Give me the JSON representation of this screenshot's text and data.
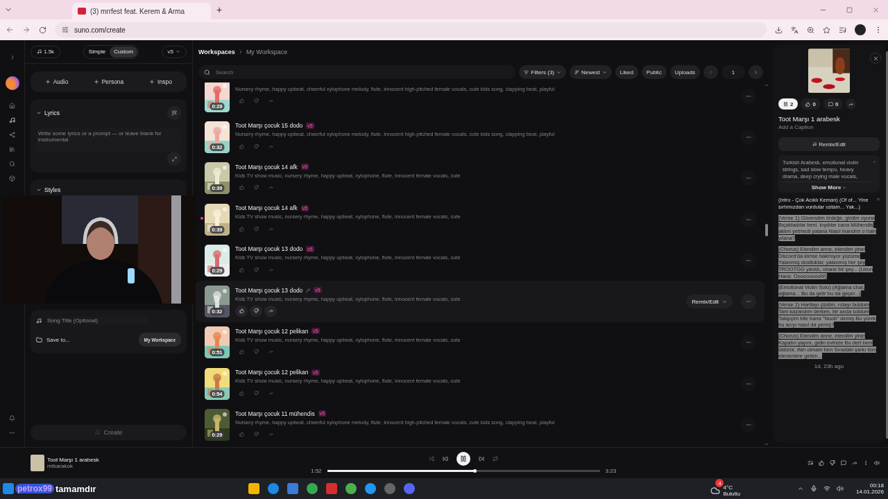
{
  "browser": {
    "tabs": [
      {
        "title": "(3) mrrfest feat. Kerem & Arma",
        "selected": true
      }
    ],
    "new_tab": "+",
    "url": "suno.com/create"
  },
  "create_panel": {
    "credits": "1.5k",
    "modes": [
      {
        "label": "Simple",
        "selected": false
      },
      {
        "label": "Custom",
        "selected": true
      }
    ],
    "model": "v5",
    "add_buttons": [
      "Audio",
      "Persona",
      "Inspo"
    ],
    "lyrics": {
      "label": "Lyrics",
      "expanded": true,
      "placeholder": "Write some lyrics or a prompt — or leave blank for instrumental"
    },
    "styles": {
      "label": "Styles",
      "expanded": true
    },
    "song_title": {
      "placeholder": "Song Title (Optional)"
    },
    "save_to": {
      "label": "Save to...",
      "value": "My Workspace"
    },
    "create": {
      "label": "Create",
      "disabled": true
    }
  },
  "workspace": {
    "breadcrumb": [
      "Workspaces",
      "My Workspace"
    ],
    "search": {
      "placeholder": "Search"
    },
    "filters": "Filters (3)",
    "sort": "Newest",
    "toggles": [
      {
        "label": "Liked",
        "selected": false
      },
      {
        "label": "Public",
        "selected": false
      },
      {
        "label": "Uploads",
        "selected": false
      }
    ],
    "page": "1",
    "songs": [
      {
        "description": "Nursery rhyme, happy upbeat, cheerful xylophone melody, flute, innocent high-pitched female vocals, cute kids song, clapping beat, playful",
        "duration": "0:29",
        "new": false,
        "hovered": false
      },
      {
        "title": "Toot Marşı çocuk 15 dodo",
        "version": "v5",
        "description": "Nursery rhyme, happy upbeat, cheerful xylophone melody, flute, innocent high-pitched female vocals, cute kids song, clapping beat, playful",
        "duration": "0:32",
        "new": false,
        "hovered": false
      },
      {
        "title": "Toot Marşı çocuk 14 afk",
        "version": "v5",
        "description": "Kids TV show music, nursery rhyme, happy upbeat, xylophone, flute, innocent female vocals, cute",
        "duration": "0:39",
        "new": false,
        "hovered": false
      },
      {
        "title": "Toot Marşı çocuk 14 afk",
        "version": "v5",
        "description": "Kids TV show music, nursery rhyme, happy upbeat, xylophone, flute, innocent female vocals, cute",
        "duration": "0:39",
        "new": true,
        "hovered": false
      },
      {
        "title": "Toot Marşı çocuk 13 dodo",
        "version": "v5",
        "description": "Kids TV show music, nursery rhyme, happy upbeat, xylophone, flute, innocent female vocals, cute",
        "duration": "0:29",
        "new": false,
        "hovered": false
      },
      {
        "title": "Toot Marşı çocuk 13 dodo",
        "version": "v5",
        "description": "Kids TV show music, nursery rhyme, happy upbeat, xylophone, flute, innocent female vocals, cute",
        "duration": "0:32",
        "new": false,
        "hovered": true,
        "remix": "Remix/Edit"
      },
      {
        "title": "Toot Marşı çocuk 12 pelikan",
        "version": "v5",
        "description": "Kids TV show music, nursery rhyme, happy upbeat, xylophone, flute, innocent female vocals, cute",
        "duration": "0:51",
        "new": false,
        "hovered": false
      },
      {
        "title": "Toot Marşı çocuk 12 pelikan",
        "version": "v5",
        "description": "Kids TV show music, nursery rhyme, happy upbeat, xylophone, flute, innocent female vocals, cute",
        "duration": "0:54",
        "new": false,
        "hovered": false
      },
      {
        "title": "Toot Marşı çocuk 11 mühendis",
        "version": "v5",
        "description": "Nursery rhyme, happy upbeat, cheerful xylophone melody, flute, innocent high-pitched female vocals, cute kids song, clapping beat, playful",
        "duration": "0:29",
        "new": false,
        "hovered": false
      }
    ]
  },
  "detail": {
    "plays": "2",
    "playing": true,
    "likes": "0",
    "comments": "0",
    "title": "Toot Marşı 1 arabesk",
    "caption_placeholder": "Add a Caption",
    "remix": "Remix/Edit",
    "style": "Turkish Arabesk, emotional violin strings, sad slow tempo, heavy drama, deep crying male vocals,",
    "show_more": "Show More",
    "lyrics_header": "(Intro - Çok Acıklı Keman) (Of of... Yine sırtımızdan vurdular ustam... Yak...)",
    "lyrics_highlighted": true,
    "lyrics": [
      "(Verse 1) Güvendim ördeğe, girdim oyuna Bıçakladılar beni, kıydılar cana Mühendis aklım yetmedi yalana Nasıl inandım o hain yılana?",
      "(Chorus) Elendim anne, elendim yine! Discord'da kimse bakmıyor yüzüme Yalanmış dostluklar, yalanmış her şey TROOTGG yıkıldı, virane bir şey... (Uzun Hava: Oooooooooh!)",
      "(Emotional Violin Solo) (Ağlama chat, ağlama... Bu da gelir bu da geçer...)",
      "(Verse 2) Haritayı çizdim, rotayı buldum Tam kazandım derken, bir anda soldum Takipçim bile bana \"Noob\" demiş Bu yürek bu acıyı nasıl da yemiş?",
      "(Chorus) Elendim anne, elendim yine! Kapatın yayını, gidin evinize Bu dert beni öldürür, ifah olmam ben Sıradaki şarkı tüm elenenlere gelsin..."
    ],
    "age": "1d, 23h ago"
  },
  "player": {
    "title": "Toot Marşı 1 arabesk",
    "artist": "mtkarakok",
    "playing": true,
    "elapsed": "1:52",
    "level": 0.54,
    "total": "3:23"
  },
  "taskbar": {
    "overlay_user": "petrox99",
    "overlay_message": "tamamdır",
    "weather_badge": "4",
    "temperature": "4°C",
    "weather": "Bulutlu",
    "time": "00:18",
    "date": "14.01.2026"
  }
}
